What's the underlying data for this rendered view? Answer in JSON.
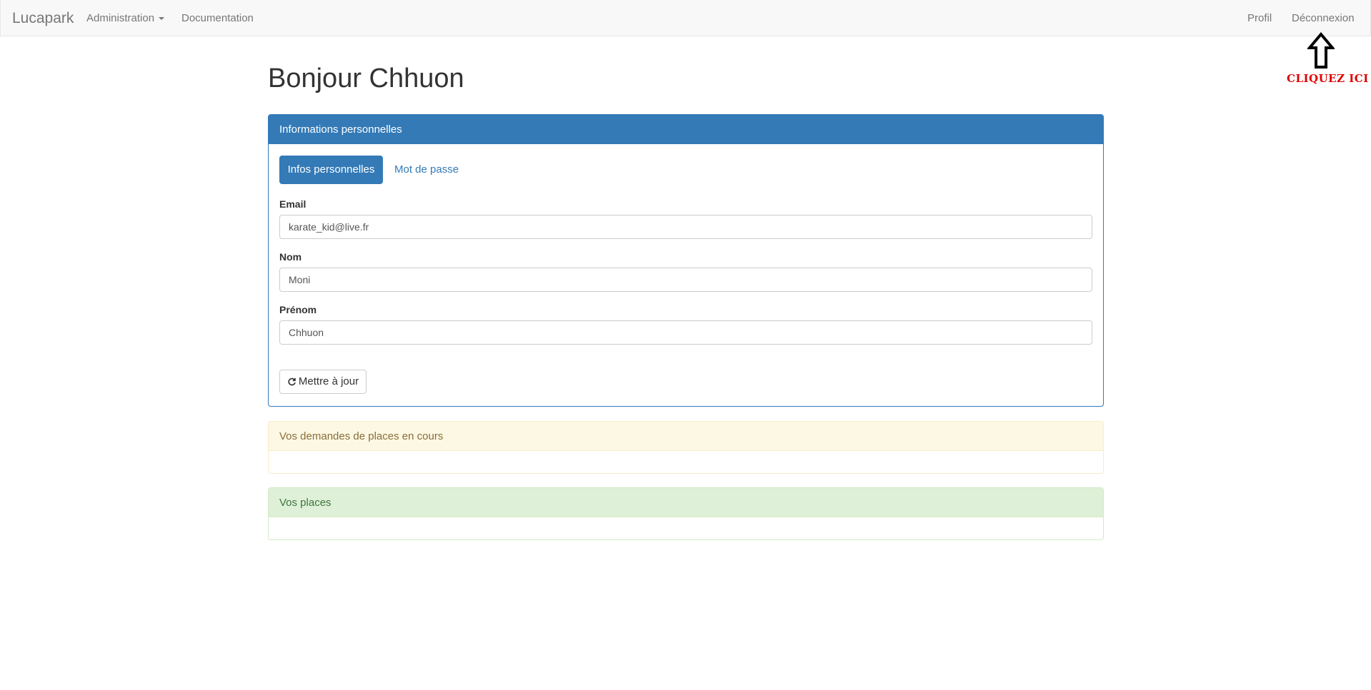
{
  "navbar": {
    "brand": "Lucapark",
    "administration": "Administration",
    "documentation": "Documentation",
    "profile": "Profil",
    "logout": "Déconnexion"
  },
  "annotation": {
    "text": "CLIQUEZ ICI",
    "color": "#e00000",
    "icon": "up-arrow-icon"
  },
  "page": {
    "title": "Bonjour Chhuon"
  },
  "personal_panel": {
    "heading": "Informations personnelles",
    "tabs": [
      {
        "label": "Infos personnelles",
        "active": true
      },
      {
        "label": "Mot de passe",
        "active": false
      }
    ],
    "fields": {
      "email": {
        "label": "Email",
        "value": "karate_kid@live.fr"
      },
      "nom": {
        "label": "Nom",
        "value": "Moni"
      },
      "prenom": {
        "label": "Prénom",
        "value": "Chhuon"
      }
    },
    "update_button": {
      "label": "Mettre à jour",
      "icon": "refresh-icon"
    }
  },
  "requests_panel": {
    "heading": "Vos demandes de places en cours"
  },
  "places_panel": {
    "heading": "Vos places"
  },
  "colors": {
    "primary": "#337ab7",
    "warning_bg": "#fcf8e3",
    "warning_text": "#8a6d3b",
    "success_bg": "#dff0d8",
    "success_text": "#3c763d"
  }
}
